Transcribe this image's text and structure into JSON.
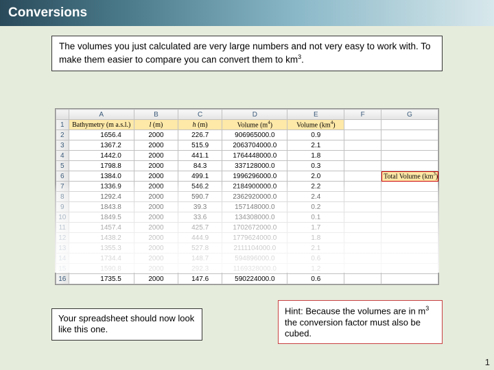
{
  "title": "Conversions",
  "intro": "The volumes you just calculated are very large numbers and not very easy to work with.  To make  them easier to compare you can convert them to km",
  "intro_sup": "3",
  "intro_tail": ".",
  "columns": [
    "A",
    "B",
    "C",
    "D",
    "E",
    "F",
    "G"
  ],
  "headers": {
    "A": "Bathymetry (m a.s.l.)",
    "B_pre": "l",
    "B_post": " (m)",
    "C_pre": "h",
    "C_post": " (m)",
    "D_pre": "Volume (m",
    "D_sup": "4",
    "D_post": ")",
    "E_pre": "Volume (km",
    "E_sup": "4",
    "E_post": ")"
  },
  "total_volume_label_pre": "Total Volume (km",
  "total_volume_label_sup": "3",
  "total_volume_label_post": ")",
  "rows": [
    {
      "n": "2",
      "a": "1656.4",
      "b": "2000",
      "c": "226.7",
      "d": "906965000.0",
      "e": "0.9"
    },
    {
      "n": "3",
      "a": "1367.2",
      "b": "2000",
      "c": "515.9",
      "d": "2063704000.0",
      "e": "2.1"
    },
    {
      "n": "4",
      "a": "1442.0",
      "b": "2000",
      "c": "441.1",
      "d": "1764448000.0",
      "e": "1.8"
    },
    {
      "n": "5",
      "a": "1798.8",
      "b": "2000",
      "c": "84.3",
      "d": "337128000.0",
      "e": "0.3"
    },
    {
      "n": "6",
      "a": "1384.0",
      "b": "2000",
      "c": "499.1",
      "d": "1996296000.0",
      "e": "2.0"
    },
    {
      "n": "7",
      "a": "1336.9",
      "b": "2000",
      "c": "546.2",
      "d": "2184900000.0",
      "e": "2.2"
    },
    {
      "n": "8",
      "a": "1292.4",
      "b": "2000",
      "c": "590.7",
      "d": "2362920000.0",
      "e": "2.4"
    },
    {
      "n": "9",
      "a": "1843.8",
      "b": "2000",
      "c": "39.3",
      "d": "157148000.0",
      "e": "0.2"
    },
    {
      "n": "10",
      "a": "1849.5",
      "b": "2000",
      "c": "33.6",
      "d": "134308000.0",
      "e": "0.1"
    },
    {
      "n": "11",
      "a": "1457.4",
      "b": "2000",
      "c": "425.7",
      "d": "1702672000.0",
      "e": "1.7"
    },
    {
      "n": "12",
      "a": "1438.2",
      "b": "2000",
      "c": "444.9",
      "d": "1779624000.0",
      "e": "1.8"
    },
    {
      "n": "13",
      "a": "1355.3",
      "b": "2000",
      "c": "527.8",
      "d": "2111104000.0",
      "e": "2.1"
    },
    {
      "n": "14",
      "a": "1734.4",
      "b": "2000",
      "c": "148.7",
      "d": "594896000.0",
      "e": "0.6"
    },
    {
      "n": "15",
      "a": "1590.8",
      "b": "2000",
      "c": "292.3",
      "d": "1169328000.0",
      "e": "1.2"
    },
    {
      "n": "16",
      "a": "1735.5",
      "b": "2000",
      "c": "147.6",
      "d": "590224000.0",
      "e": "0.6"
    }
  ],
  "caption_left": "Your spreadsheet should now look like this one.",
  "caption_right_pre": "Hint: Because the volumes are in m",
  "caption_right_sup": "3",
  "caption_right_post": " the conversion factor must also be cubed.",
  "page_number": "1"
}
